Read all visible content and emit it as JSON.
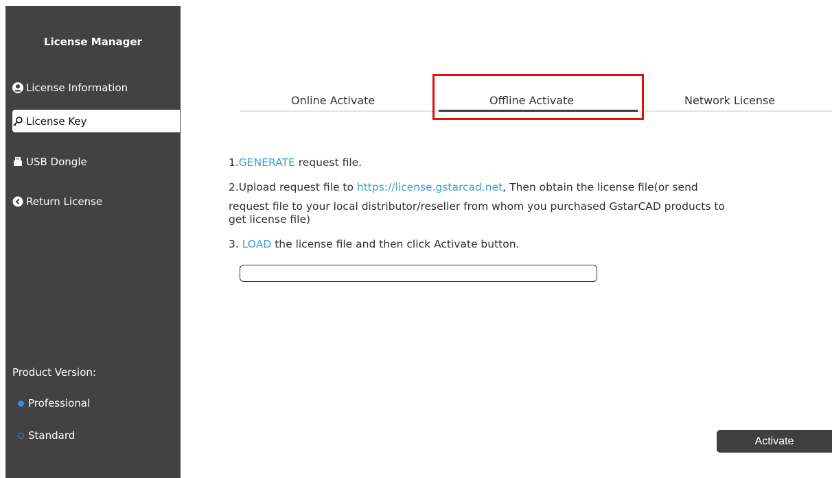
{
  "sidebar": {
    "title": "License Manager",
    "items": [
      {
        "label": "License Information",
        "icon": "user-circle-icon"
      },
      {
        "label": "License Key",
        "icon": "key-icon"
      },
      {
        "label": "USB Dongle",
        "icon": "usb-icon"
      },
      {
        "label": "Return License",
        "icon": "return-icon"
      }
    ],
    "active_item": "License Key",
    "product_version": {
      "label": "Product Version:",
      "options": [
        "Professional",
        "Standard"
      ],
      "selected": "Professional"
    }
  },
  "tabs": {
    "items": [
      "Online Activate",
      "Offline Activate",
      "Network License"
    ],
    "active": "Offline Activate"
  },
  "steps": {
    "step1": {
      "prefix": "1.",
      "link": "GENERATE",
      "suffix": " request file."
    },
    "step2": {
      "prefix": "2.Upload request file to ",
      "link": "https://license.gstarcad.net",
      "line1_suffix": ", Then obtain the license file(or send",
      "line2": "request file to your local distributor/reseller from whom you purchased GstarCAD products to",
      "line3": "get license file)"
    },
    "step3": {
      "prefix": "3. ",
      "link": "LOAD",
      "suffix": " the license file and then click Activate button."
    }
  },
  "file_path_value": "",
  "activate_label": "Activate",
  "colors": {
    "sidebar_bg": "#424242",
    "link": "#3d9cd6",
    "radio_accent": "#2f8fe0",
    "highlight": "#e01010",
    "button_bg": "#3f3f3f"
  }
}
